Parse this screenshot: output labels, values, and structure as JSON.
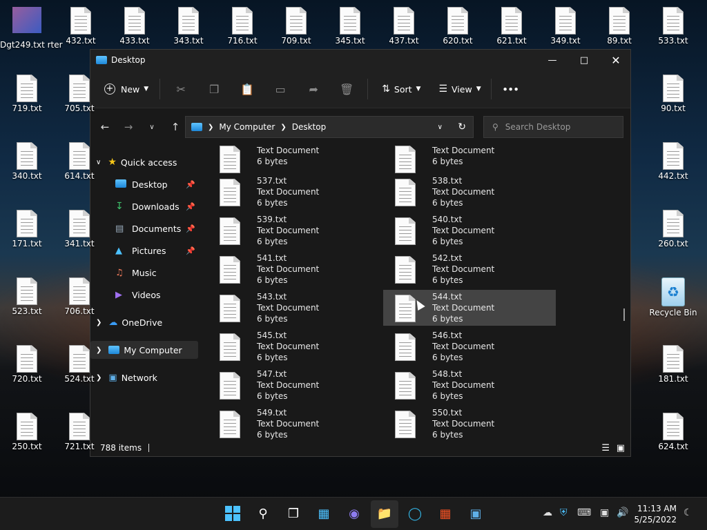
{
  "desktop": {
    "left_top_label": "Dgt249.txt rter",
    "icons_top": [
      "432.txt",
      "433.txt",
      "343.txt",
      "716.txt",
      "709.txt",
      "345.txt",
      "437.txt",
      "620.txt",
      "621.txt",
      "349.txt",
      "89.txt",
      "533.txt"
    ],
    "icons_col1": [
      "719.txt",
      "340.txt",
      "171.txt",
      "523.txt",
      "720.txt",
      "250.txt"
    ],
    "icons_col2": [
      "705.txt",
      "614.txt",
      "341.txt",
      "706.txt",
      "524.txt",
      "721.txt"
    ],
    "icons_right": [
      "90.txt",
      "442.txt",
      "260.txt",
      "Recycle Bin",
      "181.txt",
      "624.txt"
    ]
  },
  "window": {
    "title": "Desktop",
    "toolbar": {
      "new_label": "New",
      "sort_label": "Sort",
      "view_label": "View",
      "more_label": "•••"
    },
    "address": {
      "root": "My Computer",
      "current": "Desktop"
    },
    "search": {
      "placeholder": "Search Desktop"
    },
    "nav": {
      "quick_access": "Quick access",
      "items": [
        "Desktop",
        "Downloads",
        "Documents",
        "Pictures",
        "Music",
        "Videos"
      ],
      "onedrive": "OneDrive",
      "my_computer": "My Computer",
      "network": "Network"
    },
    "files": [
      {
        "name": "",
        "type": "Text Document",
        "size": "6 bytes"
      },
      {
        "name": "",
        "type": "Text Document",
        "size": "6 bytes"
      },
      {
        "name": "537.txt",
        "type": "Text Document",
        "size": "6 bytes"
      },
      {
        "name": "538.txt",
        "type": "Text Document",
        "size": "6 bytes"
      },
      {
        "name": "539.txt",
        "type": "Text Document",
        "size": "6 bytes"
      },
      {
        "name": "540.txt",
        "type": "Text Document",
        "size": "6 bytes"
      },
      {
        "name": "541.txt",
        "type": "Text Document",
        "size": "6 bytes"
      },
      {
        "name": "542.txt",
        "type": "Text Document",
        "size": "6 bytes"
      },
      {
        "name": "543.txt",
        "type": "Text Document",
        "size": "6 bytes"
      },
      {
        "name": "544.txt",
        "type": "Text Document",
        "size": "6 bytes"
      },
      {
        "name": "545.txt",
        "type": "Text Document",
        "size": "6 bytes"
      },
      {
        "name": "546.txt",
        "type": "Text Document",
        "size": "6 bytes"
      },
      {
        "name": "547.txt",
        "type": "Text Document",
        "size": "6 bytes"
      },
      {
        "name": "548.txt",
        "type": "Text Document",
        "size": "6 bytes"
      },
      {
        "name": "549.txt",
        "type": "Text Document",
        "size": "6 bytes"
      },
      {
        "name": "550.txt",
        "type": "Text Document",
        "size": "6 bytes"
      }
    ],
    "selected_file": "544.txt",
    "status": "788 items"
  },
  "taskbar": {
    "time": "11:13 AM",
    "date": "5/25/2022"
  },
  "colors": {
    "accent": "#0078d4",
    "window_bg": "#191919",
    "selected": "#444444"
  }
}
